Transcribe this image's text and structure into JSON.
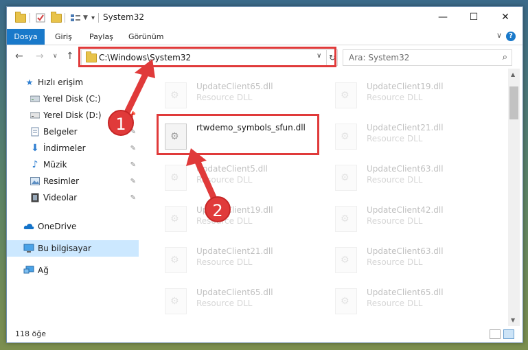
{
  "window": {
    "title": "System32",
    "controls": {
      "minimize": "—",
      "maximize": "☐",
      "close": "✕"
    }
  },
  "ribbon": {
    "tabs": [
      "Dosya",
      "Giriş",
      "Paylaş",
      "Görünüm"
    ],
    "help": "?",
    "collapse": "∨"
  },
  "address": {
    "path": "C:\\Windows\\System32",
    "dropdown": "∨",
    "refresh": "↻"
  },
  "search": {
    "placeholder": "Ara: System32",
    "icon": "⌕"
  },
  "nav": {
    "back": "←",
    "forward": "→",
    "recent": "∨",
    "up": "↑"
  },
  "sidebar": {
    "items": [
      {
        "label": "Hızlı erişim",
        "icon": "star-icon",
        "pinned": false
      },
      {
        "label": "Yerel Disk (C:)",
        "icon": "drive-icon",
        "pinned": false
      },
      {
        "label": "Yerel Disk (D:)",
        "icon": "drive-icon",
        "pinned": false
      },
      {
        "label": "Belgeler",
        "icon": "documents-icon",
        "pinned": true
      },
      {
        "label": "İndirmeler",
        "icon": "download-icon",
        "pinned": true
      },
      {
        "label": "Müzik",
        "icon": "music-icon",
        "pinned": true
      },
      {
        "label": "Resimler",
        "icon": "pictures-icon",
        "pinned": true
      },
      {
        "label": "Videolar",
        "icon": "video-icon",
        "pinned": true
      },
      {
        "label": "OneDrive",
        "icon": "onedrive-icon",
        "pinned": false
      },
      {
        "label": "Bu bilgisayar",
        "icon": "computer-icon",
        "pinned": false
      },
      {
        "label": "Ağ",
        "icon": "network-icon",
        "pinned": false
      }
    ]
  },
  "files": {
    "left": [
      {
        "name": "UpdateClient65.dll",
        "type": "Resource DLL"
      },
      {
        "name": "rtwdemo_symbols_sfun.dll",
        "type": ""
      },
      {
        "name": "UpdateClient5.dll",
        "type": "Resource DLL"
      },
      {
        "name": "UpdateClient19.dll",
        "type": "Resource DLL"
      },
      {
        "name": "UpdateClient21.dll",
        "type": "Resource DLL"
      },
      {
        "name": "UpdateClient65.dll",
        "type": "Resource DLL"
      }
    ],
    "right": [
      {
        "name": "UpdateClient19.dll",
        "type": "Resource DLL"
      },
      {
        "name": "UpdateClient21.dll",
        "type": "Resource DLL"
      },
      {
        "name": "UpdateClient63.dll",
        "type": "Resource DLL"
      },
      {
        "name": "UpdateClient42.dll",
        "type": "Resource DLL"
      },
      {
        "name": "UpdateClient63.dll",
        "type": "Resource DLL"
      },
      {
        "name": "UpdateClient65.dll",
        "type": "Resource DLL"
      }
    ]
  },
  "status": {
    "count": "118 öğe"
  },
  "annotations": {
    "step1": "1",
    "step2": "2",
    "color": "#e03a3a"
  }
}
